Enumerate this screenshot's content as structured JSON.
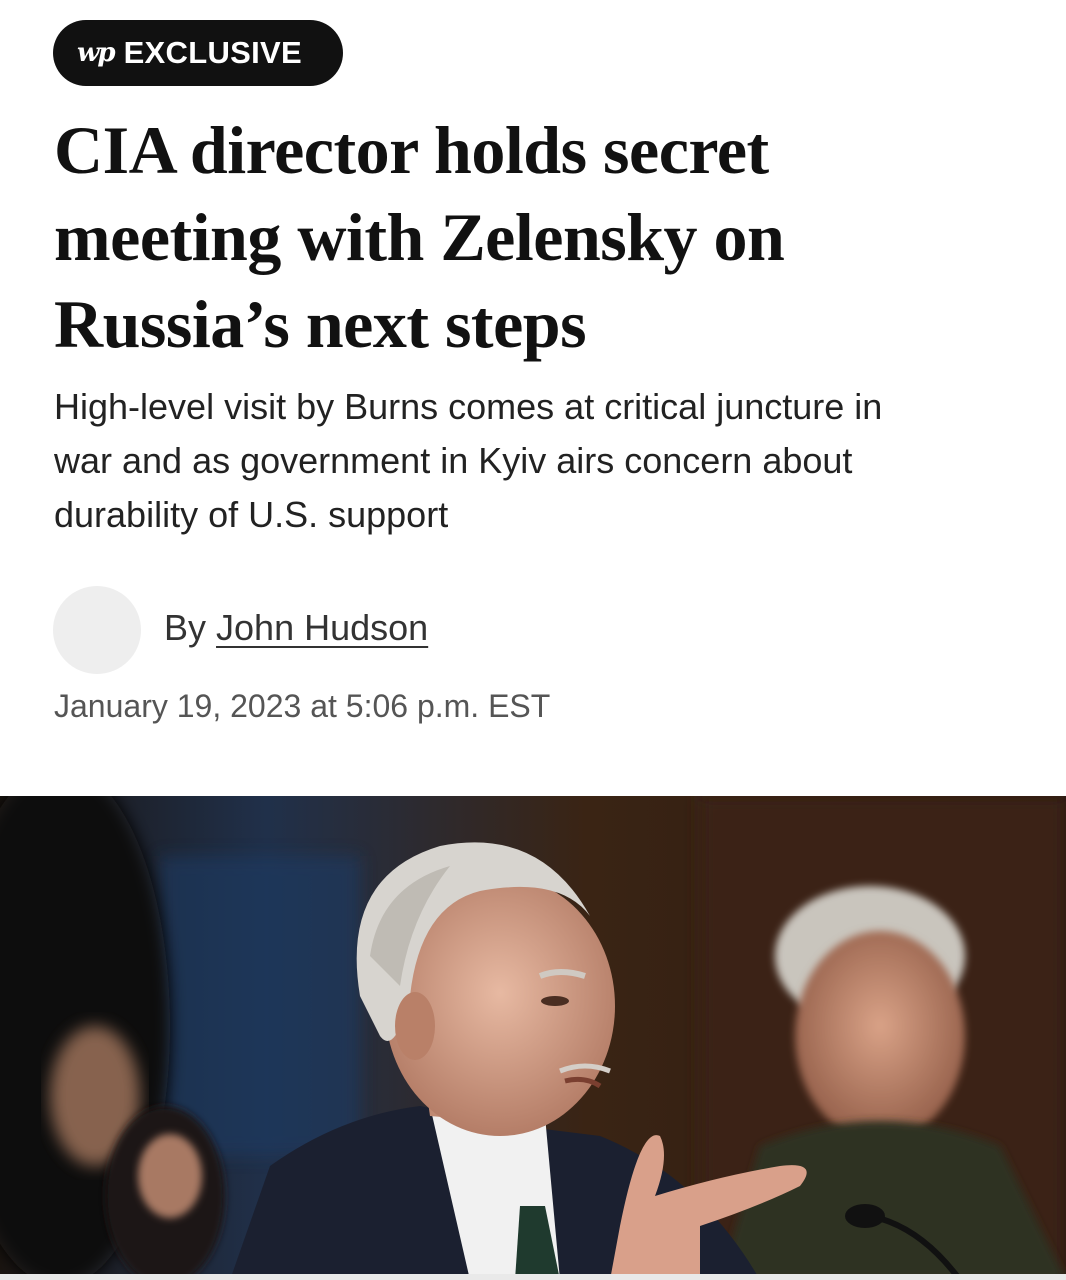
{
  "badge": {
    "logo": "wp",
    "label": "EXCLUSIVE"
  },
  "article": {
    "headline_lines": [
      "CIA director holds secret",
      "meeting with Zelensky on",
      "Russia’s next steps"
    ],
    "dek_lines": [
      "High-level visit by Burns comes at critical juncture in",
      "war and as government in Kyiv airs concern about",
      "durability of U.S. support"
    ],
    "byline_prefix": "By",
    "author": "John Hudson",
    "timestamp": "January 19, 2023 at 5:06 p.m. EST"
  }
}
